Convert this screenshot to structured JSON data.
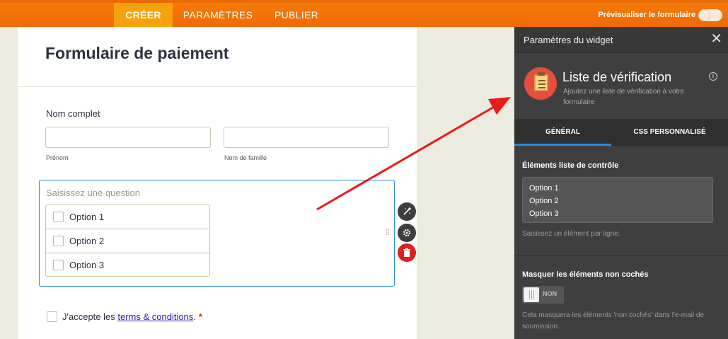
{
  "topbar": {
    "tabs": [
      "CRÉER",
      "PARAMÈTRES",
      "PUBLIER"
    ],
    "preview_label": "Prévisualiser le formulaire"
  },
  "form": {
    "title": "Formulaire de paiement",
    "full_name_label": "Nom complet",
    "first_name_sublabel": "Prénom",
    "last_name_sublabel": "Nom de famille",
    "question_placeholder": "Saisissez une question",
    "options": [
      "Option 1",
      "Option 2",
      "Option 3"
    ],
    "terms_prefix": "J'accepte les ",
    "terms_link": "terms & conditions",
    "terms_suffix": ".",
    "required_mark": "*"
  },
  "panel": {
    "title": "Paramètres du widget",
    "widget_name": "Liste de vérification",
    "widget_description": "Ajoutez une liste de vérification à votre formulaire",
    "tabs": [
      "GÉNÉRAL",
      "CSS PERSONNALISÉ"
    ],
    "items_label": "Éléments liste de contrôle",
    "items": [
      "Option 1",
      "Option 2",
      "Option 3"
    ],
    "items_hint": "Saisissez un élément par ligne.",
    "hide_label": "Masquer les éléments non cochés",
    "hide_toggle_state": "NON",
    "hide_hint": "Cela masquera les éléments 'non cochés' dans l'e-mail de soumission."
  },
  "colors": {
    "topbar": "#f47b07",
    "active_tab": "#f5a30c",
    "panel_bg": "#3f3f3f",
    "accent_blue": "#2b8ad6",
    "widget_icon_bg": "#e84c3d",
    "arrow": "#e81a1a"
  },
  "icons": [
    "close-icon",
    "info-icon",
    "checklist-icon",
    "wand-icon",
    "gear-icon",
    "trash-icon",
    "drag-handle-icon"
  ]
}
